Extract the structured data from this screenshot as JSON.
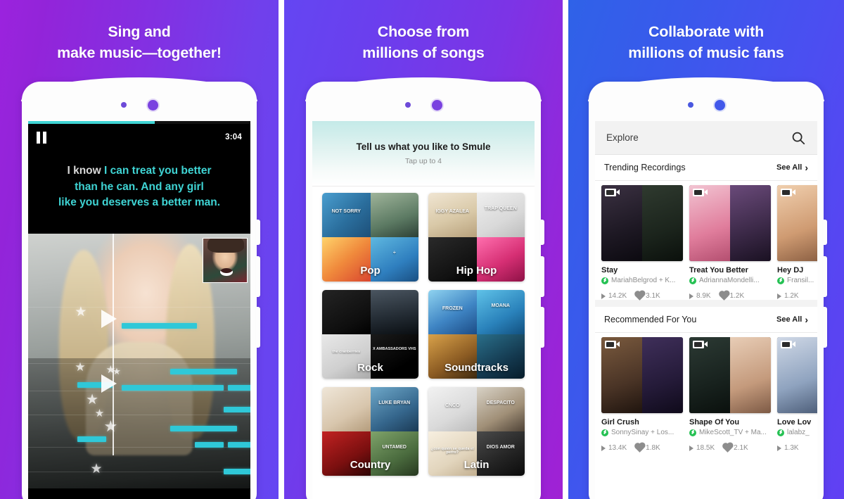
{
  "panels": [
    {
      "headline_line1": "Sing and",
      "headline_line2": "make music—together!",
      "bg_from": "#9b23de",
      "bg_to": "#6446f2",
      "player": {
        "time": "3:04",
        "progress_percent": 57,
        "pause_icon": "pause-icon",
        "lyrics_sung": "I know ",
        "lyrics_line1_rest": "I can treat you better",
        "lyrics_line2": "than he can. And any girl",
        "lyrics_line3": "like you deserves a better man.",
        "accent_color": "#3fd4d4"
      }
    },
    {
      "headline_line1": "Choose from",
      "headline_line2": "millions of songs",
      "bg_from": "#6446f2",
      "bg_to": "#a021d4",
      "prompt": {
        "title": "Tell us what you like to Smule",
        "subtitle": "Tap up to 4"
      },
      "genres": [
        [
          {
            "label": "Pop",
            "arts": [
              {
                "text": "NOT SORRY",
                "bg": "linear-gradient(135deg,#4a9ecf,#2b6f9e 55%,#1d4f78)"
              },
              {
                "text": "",
                "bg": "linear-gradient(160deg,#9fb49a,#5c7a63 60%,#2d4036)"
              },
              {
                "text": "",
                "bg": "linear-gradient(140deg,#ffd36b,#f08a3c 50%,#d9452f)"
              },
              {
                "text": "÷",
                "bg": "linear-gradient(150deg,#5fb8e0,#2f7fbf 60%,#1a4f82)"
              }
            ]
          },
          {
            "label": "Hip Hop",
            "arts": [
              {
                "text": "IGGY AZALEA",
                "bg": "linear-gradient(160deg,#f0e5d2,#d9c9a8 55%,#b8a17c)"
              },
              {
                "text": "TRAP QUEEN",
                "bg": "linear-gradient(150deg,#efefef,#d9d9d9 60%,#bdbdbd)"
              },
              {
                "text": "",
                "bg": "linear-gradient(150deg,#2a2a2a,#111 70%,#000)"
              },
              {
                "text": "",
                "bg": "linear-gradient(150deg,#ff6fae,#d62f74 55%,#8e1146)"
              }
            ]
          }
        ],
        [
          {
            "label": "Rock",
            "arts": [
              {
                "text": "",
                "bg": "linear-gradient(150deg,#242424,#0e0e0e 70%,#000)"
              },
              {
                "text": "",
                "bg": "linear-gradient(170deg,#4a5560,#222a32 60%,#0a0e12)"
              },
              {
                "text": "the cranberries",
                "bg": "linear-gradient(150deg,#e8e8e8,#cfcfcf 60%,#a9a9a9)"
              },
              {
                "text": "X AMBASSADORS VHS",
                "bg": "linear-gradient(150deg,#1a1a1a,#000 70%)"
              }
            ]
          },
          {
            "label": "Soundtracks",
            "arts": [
              {
                "text": "FROZEN",
                "bg": "linear-gradient(150deg,#8fd3f0,#3f85c4 55%,#1c4c86)"
              },
              {
                "text": "MOANA",
                "bg": "linear-gradient(150deg,#5fc2e8,#2a82bb 60%,#12507f)"
              },
              {
                "text": "",
                "bg": "linear-gradient(150deg,#d9a24a,#8a5a22 60%,#3d2910)"
              },
              {
                "text": "",
                "bg": "linear-gradient(150deg,#2a6f8a,#14394f 60%,#071c2a)"
              }
            ]
          }
        ],
        [
          {
            "label": "Country",
            "arts": [
              {
                "text": "",
                "bg": "linear-gradient(150deg,#efe6d8,#d8c6ad 60%,#b49c7c)"
              },
              {
                "text": "LUKE BRYAN",
                "bg": "linear-gradient(150deg,#6ea8c9,#35668c 60%,#1b3a55)"
              },
              {
                "text": "",
                "bg": "linear-gradient(150deg,#c22222,#7a0f0f 60%,#2e0505)"
              },
              {
                "text": "UNTAMED",
                "bg": "linear-gradient(150deg,#7fa36a,#4a6b3e 60%,#27381f)"
              }
            ]
          },
          {
            "label": "Latin",
            "arts": [
              {
                "text": "CNCO",
                "bg": "linear-gradient(150deg,#f2f2f2,#dadada 60%,#bcbcbc)"
              },
              {
                "text": "DESPACITO",
                "bg": "linear-gradient(150deg,#d8d2c6,#a08f77 60%,#4e4236)"
              },
              {
                "text": "¿con quién se queda el perro?",
                "bg": "linear-gradient(150deg,#f7efe0,#e2d5bd 60%,#c3b091)"
              },
              {
                "text": "DIOS AMOR",
                "bg": "linear-gradient(150deg,#4a4a4a,#222 60%,#0b0b0b)"
              }
            ]
          }
        ]
      ]
    },
    {
      "headline_line1": "Collaborate with",
      "headline_line2": "millions of music fans",
      "bg_from": "#2f62e8",
      "bg_to": "#6140f3",
      "explore": {
        "search_placeholder": "Explore",
        "search_icon": "search-icon",
        "sections": [
          {
            "title": "Trending Recordings",
            "see_all": "See All",
            "cards": [
              {
                "title": "Stay",
                "user": "MariahBelgrod + K...",
                "plays": "14.2K",
                "likes": "3.1K",
                "left_bg": "linear-gradient(160deg,#3b3142,#1d1823 60%,#0c0a10)",
                "right_bg": "linear-gradient(160deg,#2f3a2f,#1b241c 60%,#0b100c)"
              },
              {
                "title": "Treat You Better",
                "user": "AdriannaMondelli...",
                "plays": "8.9K",
                "likes": "1.2K",
                "left_bg": "linear-gradient(160deg,#f2c4d2,#e07d9c 60%,#b44f70)",
                "right_bg": "linear-gradient(160deg,#6a4a7a,#3a2846 60%,#1a1122)"
              },
              {
                "title": "Hey DJ",
                "user": "Fransil...",
                "plays": "1.2K",
                "likes": "",
                "left_bg": "linear-gradient(160deg,#f0cfae,#cf9b72 60%,#8d6144)",
                "right_bg": "linear-gradient(160deg,#f0cfae,#cf9b72 60%,#8d6144)"
              }
            ]
          },
          {
            "title": "Recommended For You",
            "see_all": "See All",
            "cards": [
              {
                "title": "Girl Crush",
                "user": "SonnySinay + Los...",
                "plays": "13.4K",
                "likes": "1.8K",
                "left_bg": "linear-gradient(160deg,#7a5a3e,#4a3426 60%,#1f140e)",
                "right_bg": "linear-gradient(160deg,#3f2f5a,#241a38 60%,#0f0a1a)"
              },
              {
                "title": "Shape Of You",
                "user": "MikeScott_TV + Ma...",
                "plays": "18.5K",
                "likes": "2.1K",
                "left_bg": "linear-gradient(160deg,#2c3a34,#18221e 60%,#0a100d)",
                "right_bg": "linear-gradient(160deg,#e8cdb6,#c49a7c 60%,#7d5a45)"
              },
              {
                "title": "Love Lov",
                "user": "lalabz_",
                "plays": "1.3K",
                "likes": "",
                "left_bg": "linear-gradient(160deg,#cfd8e6,#8fa3bf 60%,#4e5f7a)",
                "right_bg": "linear-gradient(160deg,#cfd8e6,#8fa3bf 60%,#4e5f7a)"
              }
            ]
          }
        ]
      }
    }
  ]
}
